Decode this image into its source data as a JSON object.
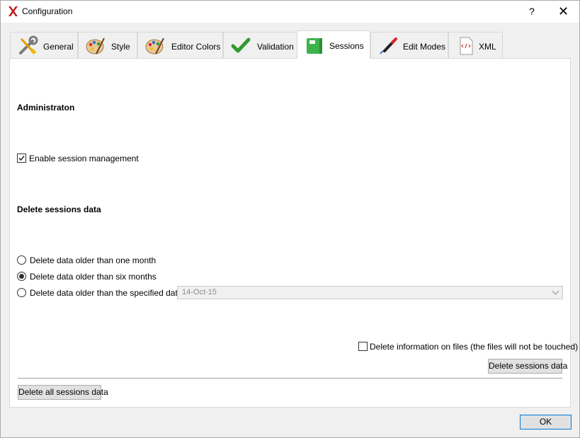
{
  "window": {
    "title": "Configuration",
    "help_label": "?",
    "close_label": "✕"
  },
  "tabs": [
    {
      "label": "General",
      "icon": "wrench-screwdriver-icon"
    },
    {
      "label": "Style",
      "icon": "palette-icon"
    },
    {
      "label": "Editor Colors",
      "icon": "palette-icon"
    },
    {
      "label": "Validation",
      "icon": "checkmark-icon"
    },
    {
      "label": "Sessions",
      "icon": "green-folder-icon",
      "active": true
    },
    {
      "label": "Edit Modes",
      "icon": "pen-icon"
    },
    {
      "label": "XML",
      "icon": "xml-document-icon"
    }
  ],
  "sessions": {
    "admin_heading": "Administraton",
    "enable_label": "Enable session management",
    "enable_checked": true,
    "delete_heading": "Delete sessions data",
    "options": [
      {
        "label": "Delete data older than one month",
        "selected": false
      },
      {
        "label": "Delete data older than six months",
        "selected": true
      },
      {
        "label": "Delete data older than the specified date",
        "selected": false
      }
    ],
    "date_value": "14-Oct-15",
    "delete_info_label": "Delete information on files (the files will not be touched)",
    "delete_info_checked": false,
    "delete_button": "Delete sessions data",
    "delete_all_button": "Delete all sessions data"
  },
  "footer": {
    "ok_label": "OK"
  }
}
